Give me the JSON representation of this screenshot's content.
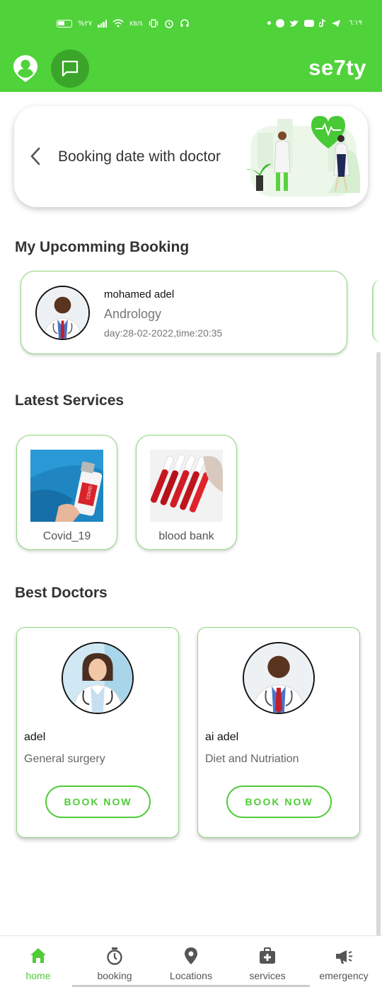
{
  "status_bar": {
    "left_text": "%٢٧",
    "net_speed": "KB/S",
    "time": "٦:١٩"
  },
  "app_bar": {
    "brand": "se7ty"
  },
  "hero": {
    "title": "Booking date with doctor"
  },
  "upcoming": {
    "section_title": "My Upcomming Booking",
    "booking": {
      "doctor_name": "mohamed adel",
      "specialty": "Andrology",
      "datetime": "day:28-02-2022,time:20:35"
    }
  },
  "services": {
    "section_title": "Latest Services",
    "items": [
      {
        "label": "Covid_19",
        "image": "covid-vaccine"
      },
      {
        "label": "blood bank",
        "image": "blood-tubes"
      }
    ]
  },
  "doctors": {
    "section_title": "Best Doctors",
    "items": [
      {
        "name": "adel",
        "specialty": "General surgery",
        "button": "BOOK NOW"
      },
      {
        "name": "ai adel",
        "specialty": "Diet and Nutriation",
        "button": "BOOK NOW"
      }
    ]
  },
  "bottom_nav": {
    "items": [
      {
        "label": "home",
        "icon": "home-icon",
        "active": true
      },
      {
        "label": "booking",
        "icon": "timer-icon",
        "active": false
      },
      {
        "label": "Locations",
        "icon": "location-pin-icon",
        "active": false
      },
      {
        "label": "services",
        "icon": "medical-kit-icon",
        "active": false
      },
      {
        "label": "emergency",
        "icon": "megaphone-icon",
        "active": false
      }
    ]
  },
  "colors": {
    "primary": "#4fd23a",
    "primary_dark": "#3aa52a",
    "card_border": "#8fd77f"
  }
}
